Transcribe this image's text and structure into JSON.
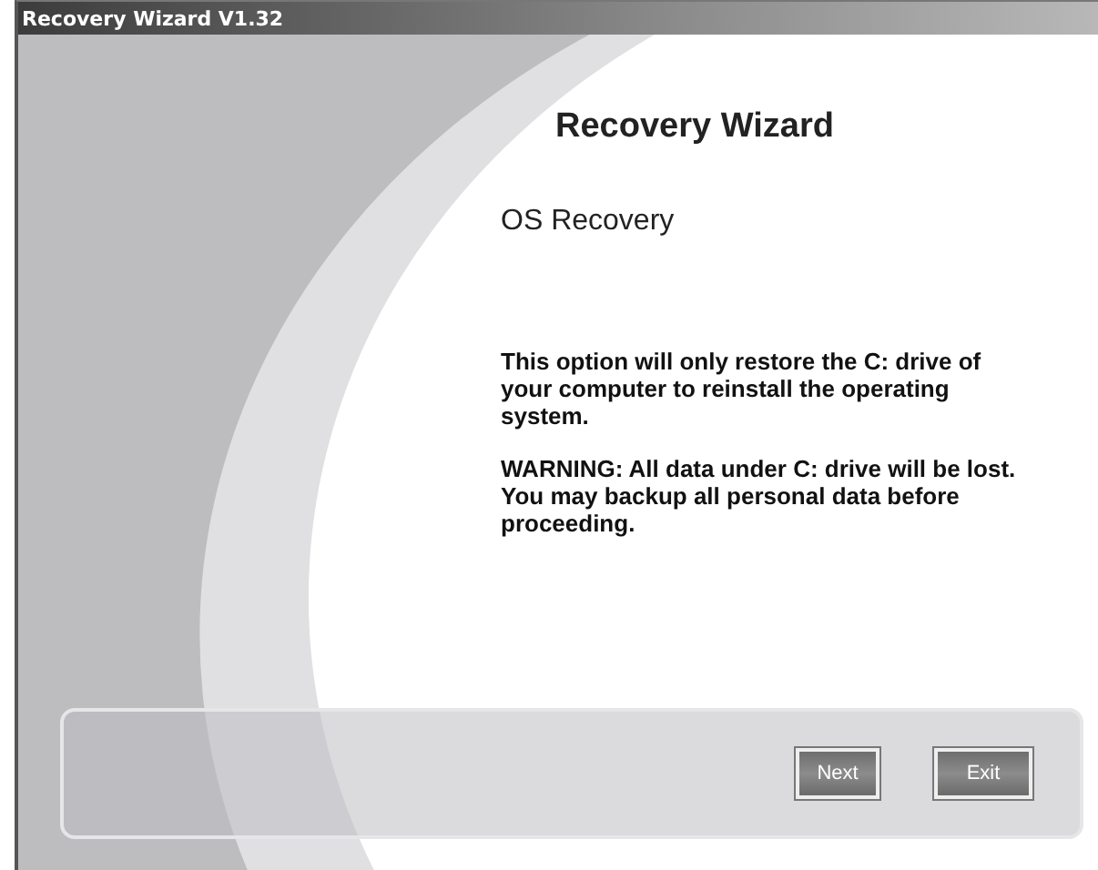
{
  "window": {
    "title": "Recovery Wizard V1.32"
  },
  "heading": "Recovery Wizard",
  "section_title": "OS Recovery",
  "paragraphs": [
    "This option will only restore the C: drive of your computer to reinstall the operating system.",
    "WARNING: All data under C: drive will be lost. You may backup all personal data before proceeding."
  ],
  "buttons": [
    "Next",
    "Exit"
  ]
}
